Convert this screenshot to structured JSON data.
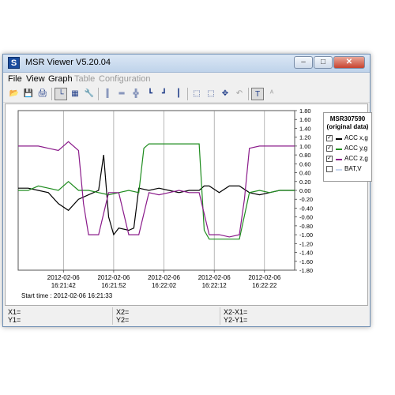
{
  "window": {
    "title": "MSR Viewer V5.20.04",
    "icon_letter": "S"
  },
  "titlebar_buttons": {
    "minimize": "–",
    "maximize": "□",
    "close": "✕"
  },
  "menu": [
    {
      "label": "File",
      "enabled": true
    },
    {
      "label": "View",
      "enabled": true
    },
    {
      "label": "Graph",
      "enabled": true
    },
    {
      "label": "Table",
      "enabled": false
    },
    {
      "label": "Configuration",
      "enabled": false
    }
  ],
  "toolbar": [
    {
      "name": "open-folder-icon",
      "glyph": "📂",
      "enabled": true
    },
    {
      "name": "save-icon",
      "glyph": "💾",
      "enabled": false
    },
    {
      "name": "print-icon",
      "glyph": "🖨",
      "enabled": true
    },
    {
      "name": "graph-view-icon",
      "glyph": "└",
      "enabled": true,
      "pressed": true
    },
    {
      "name": "table-view-icon",
      "glyph": "▦",
      "enabled": true
    },
    {
      "name": "settings-wrench-icon",
      "glyph": "🔧",
      "enabled": true
    },
    {
      "name": "zoom-x-icon",
      "glyph": "║",
      "enabled": true
    },
    {
      "name": "zoom-y-icon",
      "glyph": "═",
      "enabled": true
    },
    {
      "name": "zoom-xy-icon",
      "glyph": "╬",
      "enabled": true
    },
    {
      "name": "cursor-1-icon",
      "glyph": "┗",
      "enabled": true
    },
    {
      "name": "cursor-2-icon",
      "glyph": "┛",
      "enabled": true
    },
    {
      "name": "cursor-line-icon",
      "glyph": "┃",
      "enabled": true
    },
    {
      "name": "zoom-in-icon",
      "glyph": "⬚",
      "enabled": true
    },
    {
      "name": "zoom-out-icon",
      "glyph": "⬚",
      "enabled": true
    },
    {
      "name": "pan-move-icon",
      "glyph": "✥",
      "enabled": true
    },
    {
      "name": "undo-icon",
      "glyph": "↶",
      "enabled": false
    },
    {
      "name": "text-annotation-icon",
      "glyph": "T",
      "enabled": true,
      "pressed": true
    },
    {
      "name": "text-add-icon",
      "glyph": "ᴬ",
      "enabled": false
    }
  ],
  "legend": {
    "title_line1": "MSR307590",
    "title_line2": "(original data)",
    "items": [
      {
        "label": "ACC x,g",
        "color": "#000000",
        "checked": true
      },
      {
        "label": "ACC y,g",
        "color": "#1e8c1e",
        "checked": true
      },
      {
        "label": "ACC z,g",
        "color": "#8a1a8a",
        "checked": true
      },
      {
        "label": "BAT,V",
        "color": "#c8d8f0",
        "checked": false
      }
    ]
  },
  "status": {
    "x1": "X1=",
    "y1": "Y1=",
    "x2": "X2=",
    "y2": "Y2=",
    "x2x1": "X2-X1=",
    "y2y1": "Y2-Y1="
  },
  "chart_data": {
    "type": "line",
    "title": "",
    "xlabel": "",
    "ylabel": "",
    "start_time_label": "Start time : 2012-02-06 16:21:33",
    "ylim": [
      -1.8,
      1.8
    ],
    "y_ticks": [
      "1.80",
      "1.60",
      "1.40",
      "1.20",
      "1.00",
      "0.80",
      "0.60",
      "0.40",
      "0.20",
      "0.00",
      "-0.20",
      "-0.40",
      "-0.60",
      "-0.80",
      "-1.00",
      "-1.20",
      "-1.40",
      "-1.60",
      "-1.80"
    ],
    "xlim": [
      0,
      55
    ],
    "x_tick_positions": [
      9,
      19,
      29,
      39,
      49
    ],
    "x_ticks": [
      {
        "date": "2012-02-06",
        "time": "16:21:42"
      },
      {
        "date": "2012-02-06",
        "time": "16:21:52"
      },
      {
        "date": "2012-02-06",
        "time": "16:22:02"
      },
      {
        "date": "2012-02-06",
        "time": "16:22:12"
      },
      {
        "date": "2012-02-06",
        "time": "16:22:22"
      }
    ],
    "grid": "vertical",
    "series": [
      {
        "name": "ACC x,g",
        "color": "#000000",
        "x": [
          0,
          2,
          4,
          6,
          8,
          10,
          12,
          14,
          16,
          17,
          18,
          19,
          20,
          22,
          23,
          24,
          26,
          28,
          30,
          32,
          34,
          36,
          37,
          38,
          40,
          42,
          44,
          46,
          48,
          50,
          52,
          55
        ],
        "y": [
          0.05,
          0.05,
          0.0,
          -0.05,
          -0.3,
          -0.45,
          -0.2,
          -0.1,
          0.0,
          0.8,
          -0.6,
          -1.0,
          -0.85,
          -0.9,
          -0.85,
          0.05,
          0.0,
          0.05,
          0.0,
          -0.05,
          0.0,
          0.0,
          0.1,
          0.1,
          -0.05,
          0.1,
          0.1,
          -0.05,
          -0.1,
          -0.05,
          0.0,
          0.0
        ]
      },
      {
        "name": "ACC y,g",
        "color": "#1e8c1e",
        "x": [
          0,
          2,
          4,
          6,
          8,
          10,
          12,
          14,
          16,
          18,
          20,
          22,
          24,
          25,
          26,
          28,
          30,
          32,
          34,
          36,
          37,
          38,
          40,
          42,
          44,
          46,
          48,
          50,
          52,
          55
        ],
        "y": [
          0.0,
          0.0,
          0.1,
          0.05,
          0.0,
          0.2,
          0.0,
          0.0,
          -0.05,
          -0.1,
          -0.05,
          0.0,
          -0.05,
          0.95,
          1.05,
          1.05,
          1.05,
          1.05,
          1.05,
          1.05,
          -0.9,
          -1.1,
          -1.1,
          -1.1,
          -1.1,
          -0.05,
          0.0,
          -0.05,
          0.0,
          0.0
        ]
      },
      {
        "name": "ACC z,g",
        "color": "#8a1a8a",
        "x": [
          0,
          2,
          4,
          6,
          8,
          10,
          12,
          13,
          14,
          16,
          18,
          20,
          22,
          24,
          26,
          28,
          30,
          32,
          34,
          36,
          38,
          40,
          42,
          44,
          45,
          46,
          48,
          50,
          52,
          55
        ],
        "y": [
          1.0,
          1.0,
          1.0,
          0.95,
          0.9,
          1.1,
          0.9,
          -0.3,
          -1.0,
          -1.0,
          -0.05,
          -0.05,
          -1.0,
          -1.0,
          -0.05,
          -0.1,
          -0.05,
          0.0,
          -0.05,
          -0.05,
          -1.0,
          -1.0,
          -1.05,
          -1.0,
          -0.2,
          0.95,
          1.0,
          1.0,
          1.0,
          1.0
        ]
      }
    ]
  }
}
